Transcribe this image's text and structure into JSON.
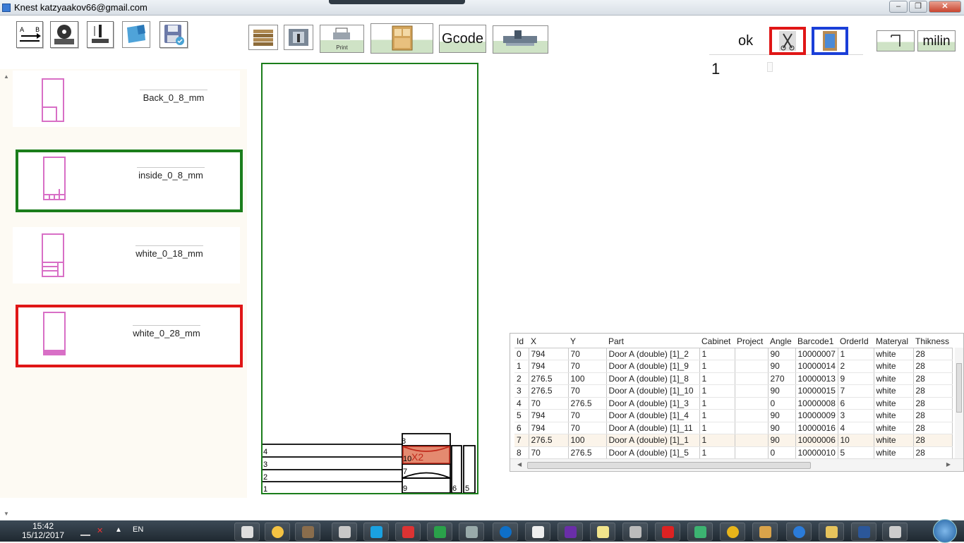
{
  "window": {
    "title": "Knest katzyaakov66@gmail.com"
  },
  "toolbar": {
    "print_label": "Print",
    "gcode_label": "Gcode",
    "ok_label": "ok",
    "milin_label": "milin",
    "counter_value": "1"
  },
  "materials": [
    {
      "name": "Back_0_8_mm"
    },
    {
      "name": "inside_0_8_mm"
    },
    {
      "name": "white_0_18_mm"
    },
    {
      "name": "white_0_28_mm"
    }
  ],
  "sheet": {
    "labels": [
      "4",
      "3",
      "2",
      "1",
      "8",
      "10",
      "7",
      "9",
      "6",
      "5"
    ],
    "highlight_label": "X2"
  },
  "grid": {
    "columns": [
      "Id",
      "X",
      "Y",
      "Part",
      "Cabinet",
      "Project",
      "Angle",
      "Barcode1",
      "OrderId",
      "Materyal",
      "Thikness"
    ],
    "rows": [
      [
        "0",
        "794",
        "70",
        "Door A (double) [1]_2",
        "1",
        "",
        "90",
        "10000007",
        "1",
        "white",
        "28"
      ],
      [
        "1",
        "794",
        "70",
        "Door A (double) [1]_9",
        "1",
        "",
        "90",
        "10000014",
        "2",
        "white",
        "28"
      ],
      [
        "2",
        "276.5",
        "100",
        "Door A (double) [1]_8",
        "1",
        "",
        "270",
        "10000013",
        "9",
        "white",
        "28"
      ],
      [
        "3",
        "276.5",
        "70",
        "Door A (double) [1]_10",
        "1",
        "",
        "90",
        "10000015",
        "7",
        "white",
        "28"
      ],
      [
        "4",
        "70",
        "276.5",
        "Door A (double) [1]_3",
        "1",
        "",
        "0",
        "10000008",
        "6",
        "white",
        "28"
      ],
      [
        "5",
        "794",
        "70",
        "Door A (double) [1]_4",
        "1",
        "",
        "90",
        "10000009",
        "3",
        "white",
        "28"
      ],
      [
        "6",
        "794",
        "70",
        "Door A (double) [1]_11",
        "1",
        "",
        "90",
        "10000016",
        "4",
        "white",
        "28"
      ],
      [
        "7",
        "276.5",
        "100",
        "Door A (double) [1]_1",
        "1",
        "",
        "90",
        "10000006",
        "10",
        "white",
        "28"
      ],
      [
        "8",
        "70",
        "276.5",
        "Door A (double) [1]_5",
        "1",
        "",
        "0",
        "10000010",
        "5",
        "white",
        "28"
      ]
    ]
  },
  "taskbar": {
    "time": "15:42",
    "date": "15/12/2017",
    "lang": "EN"
  }
}
